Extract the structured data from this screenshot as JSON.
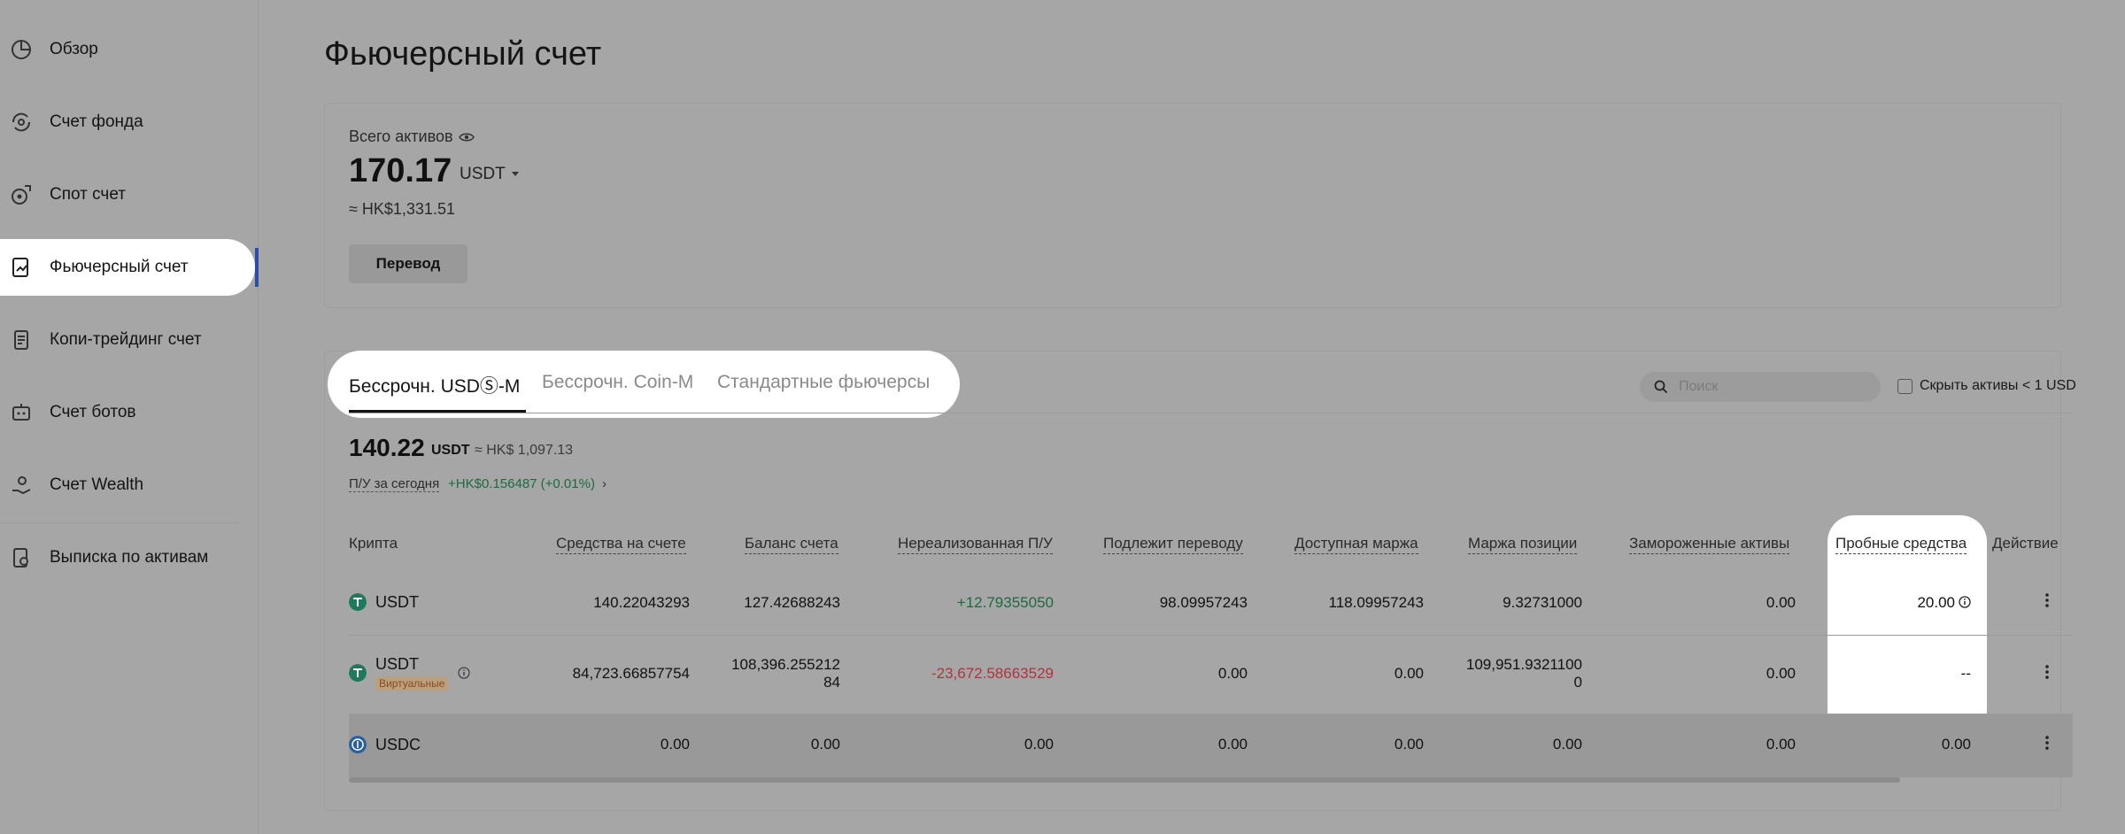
{
  "sidebar": {
    "items": [
      {
        "label": "Обзор",
        "icon": "pie-chart-icon"
      },
      {
        "label": "Счет фонда",
        "icon": "fund-cycle-icon"
      },
      {
        "label": "Спот счет",
        "icon": "spot-coin-icon"
      },
      {
        "label": "Фьючерсный счет",
        "icon": "futures-doc-icon",
        "active": true
      },
      {
        "label": "Копи-трейдинг счет",
        "icon": "copy-trading-icon"
      },
      {
        "label": "Счет ботов",
        "icon": "bot-icon"
      },
      {
        "label": "Счет Wealth",
        "icon": "wealth-hand-icon"
      },
      {
        "label": "Выписка по активам",
        "icon": "statement-icon"
      }
    ]
  },
  "page": {
    "title": "Фьючерсный счет"
  },
  "overview": {
    "total_label": "Всего активов",
    "total_value": "170.17",
    "currency": "USDT",
    "approx": "≈ HK$1,331.51",
    "transfer_label": "Перевод"
  },
  "tabs": [
    {
      "label": "Бессрочн. USDⓈ-M",
      "active": true
    },
    {
      "label": "Бессрочн. Coin-M"
    },
    {
      "label": "Стандартные фьючерсы"
    }
  ],
  "search": {
    "placeholder": "Поиск"
  },
  "hide_small": {
    "label": "Скрыть активы < 1 USD",
    "checked": false
  },
  "balance": {
    "value": "140.22",
    "unit": "USDT",
    "approx": "≈ HK$ 1,097.13",
    "pnl_label": "П/У за сегодня",
    "pnl_value": "+HK$0.156487 (+0.01%)"
  },
  "table": {
    "headers": {
      "crypto": "Крипта",
      "funds": "Средства на счете",
      "balance": "Баланс счета",
      "unrealized": "Нереализованная П/У",
      "transferable": "Подлежит переводу",
      "available_margin": "Доступная маржа",
      "position_margin": "Маржа позиции",
      "frozen": "Замороженные активы",
      "trial": "Пробные средства",
      "action": "Действие"
    },
    "rows": [
      {
        "coin": "USDT",
        "badge": "",
        "funds": "140.22043293",
        "balance": "127.42688243",
        "unrealized": "+12.79355050",
        "transferable": "98.09957243",
        "available_margin": "118.09957243",
        "position_margin": "9.32731000",
        "frozen": "0.00",
        "trial": "20.00"
      },
      {
        "coin": "USDT",
        "badge": "Виртуальные",
        "funds": "84,723.66857754",
        "balance_l1": "108,396.255212",
        "balance_l2": "84",
        "unrealized": "-23,672.58663529",
        "transferable": "0.00",
        "available_margin": "0.00",
        "pm_l1": "109,951.9321100",
        "pm_l2": "0",
        "frozen": "0.00",
        "trial": "--"
      },
      {
        "coin": "USDC",
        "badge": "",
        "funds": "0.00",
        "balance": "0.00",
        "unrealized": "0.00",
        "transferable": "0.00",
        "available_margin": "0.00",
        "position_margin": "0.00",
        "frozen": "0.00",
        "trial": "0.00"
      }
    ]
  },
  "colors": {
    "positive": "#1c6b3e",
    "negative": "#b2323f",
    "accent": "#2b4fa8",
    "usdt": "#26a17b",
    "usdc": "#2775ca"
  }
}
